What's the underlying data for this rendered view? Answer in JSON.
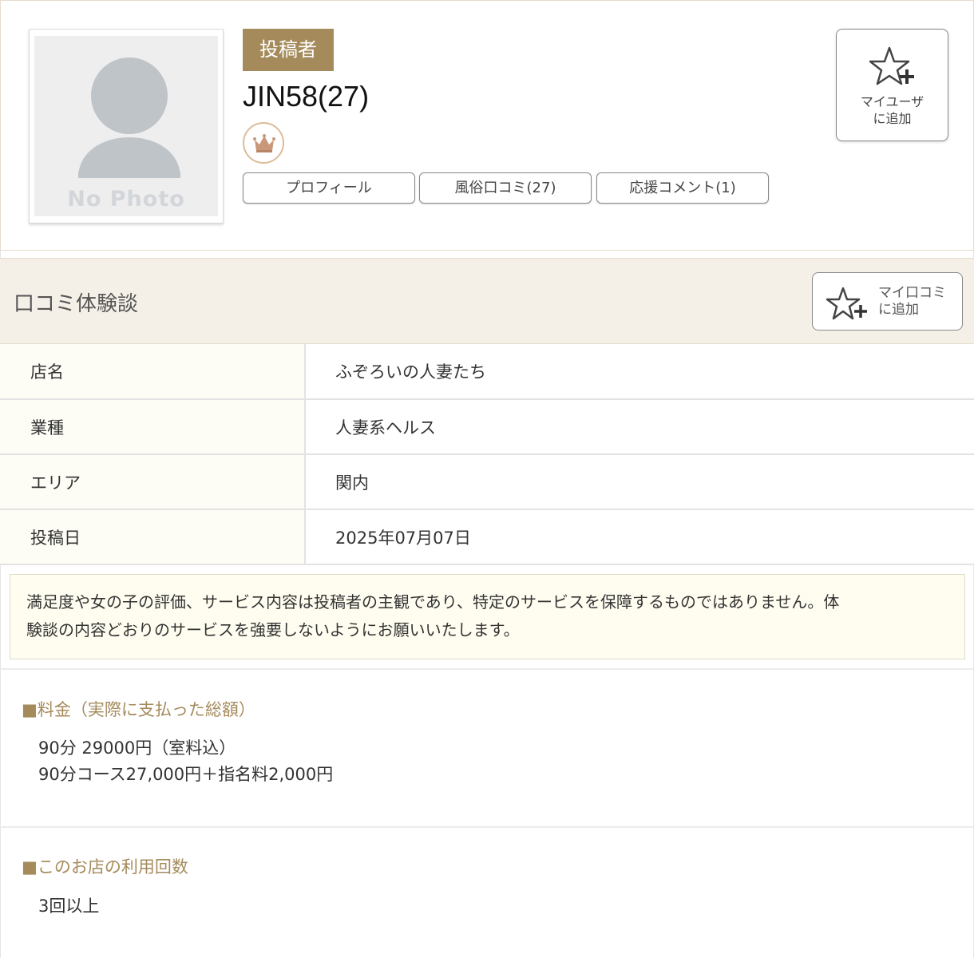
{
  "profile": {
    "avatar_text": "No Photo",
    "badge": "投稿者",
    "username": "JIN58(27)",
    "rank_icon": "crown-icon",
    "tabs": [
      {
        "label": "プロフィール"
      },
      {
        "label": "風俗口コミ(27)"
      },
      {
        "label": "応援コメント(1)"
      }
    ],
    "add_user": {
      "line1": "マイユーザ",
      "line2": "に追加"
    }
  },
  "review": {
    "section_title": "口コミ体験談",
    "add_review": {
      "line1": "マイ口コミ",
      "line2": "に追加"
    },
    "rows": [
      {
        "key": "店名",
        "value": "ふぞろいの人妻たち"
      },
      {
        "key": "業種",
        "value": "人妻系ヘルス"
      },
      {
        "key": "エリア",
        "value": "関内"
      },
      {
        "key": "投稿日",
        "value": "2025年07月07日"
      }
    ],
    "notice_line1": "満足度や女の子の評価、サービス内容は投稿者の主観であり、特定のサービスを保障するものではありません。体",
    "notice_line2": "験談の内容どおりのサービスを強要しないようにお願いいたします。",
    "price": {
      "title": "■料金（実際に支払った総額）",
      "line1": "90分 29000円（室料込）",
      "line2": "90分コース27,000円＋指名料2,000円"
    },
    "visits": {
      "title": "■このお店の利用回数",
      "value": "3回以上"
    }
  },
  "colors": {
    "accent": "#a58b5c",
    "header_bg": "#f5f0e7",
    "key_bg": "#fdfcf5",
    "notice_bg": "#fffdf0"
  }
}
